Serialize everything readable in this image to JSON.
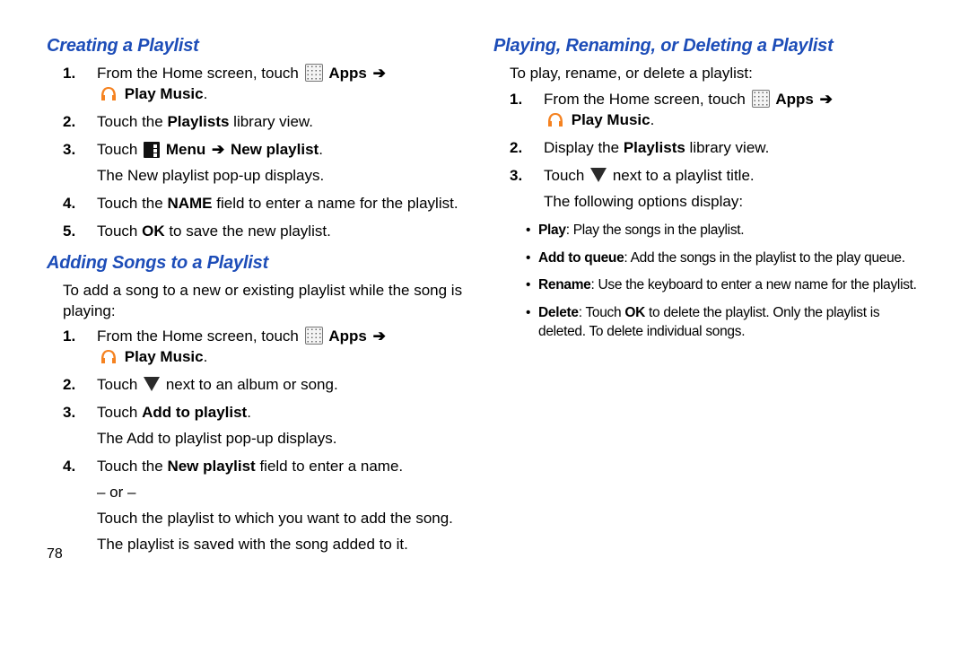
{
  "pageNumber": "78",
  "arrow": "➔",
  "left": {
    "section1": {
      "heading": "Creating a Playlist",
      "steps": [
        {
          "num": "1.",
          "pre": "From the Home screen, touch ",
          "apps": "Apps",
          "playmusic": "Play Music",
          "after": "."
        },
        {
          "num": "2.",
          "t1": "Touch the ",
          "b1": "Playlists",
          "t2": " library view."
        },
        {
          "num": "3.",
          "t1": "Touch ",
          "b1": "Menu",
          "b2": "New playlist",
          "t2": ".",
          "cont": "The New playlist pop-up displays."
        },
        {
          "num": "4.",
          "t1": "Touch the ",
          "b1": "NAME",
          "t2": " field to enter a name for the playlist."
        },
        {
          "num": "5.",
          "t1": "Touch ",
          "b1": "OK",
          "t2": " to save the new playlist."
        }
      ]
    },
    "section2": {
      "heading": "Adding Songs to a Playlist",
      "intro": "To add a song to a new or existing playlist while the song is playing:",
      "steps": [
        {
          "num": "1.",
          "pre": "From the Home screen, touch ",
          "apps": "Apps",
          "playmusic": "Play Music",
          "after": "."
        },
        {
          "num": "2.",
          "t1": "Touch ",
          "t2": " next to an album or song."
        },
        {
          "num": "3.",
          "t1": "Touch ",
          "b1": "Add to playlist",
          "t2": ".",
          "cont": "The Add to playlist pop-up displays."
        },
        {
          "num": "4.",
          "t1": "Touch the ",
          "b1": "New playlist",
          "t2": " field to enter a name.",
          "cont": "– or –",
          "cont2": "Touch the playlist to which you want to add the song.",
          "cont3": "The playlist is saved with the song added to it."
        }
      ]
    }
  },
  "right": {
    "section1": {
      "heading": "Playing, Renaming, or Deleting a Playlist",
      "intro": "To play, rename, or delete a playlist:",
      "steps": [
        {
          "num": "1.",
          "pre": "From the Home screen, touch ",
          "apps": "Apps",
          "playmusic": "Play Music",
          "after": "."
        },
        {
          "num": "2.",
          "t1": "Display the ",
          "b1": "Playlists",
          "t2": " library view."
        },
        {
          "num": "3.",
          "t1": "Touch ",
          "t2": " next to a playlist title.",
          "cont": "The following options display:"
        }
      ],
      "options": [
        {
          "b": "Play",
          "t": ": Play the songs in the playlist."
        },
        {
          "b": "Add to queue",
          "t": ": Add the songs in the playlist to the play queue."
        },
        {
          "b": "Rename",
          "t": ": Use the keyboard to enter a new name for the playlist."
        },
        {
          "b": "Delete",
          "t1": ": Touch ",
          "b2": "OK",
          "t2": " to delete the playlist. Only the playlist is deleted. To delete individual songs."
        }
      ]
    }
  }
}
